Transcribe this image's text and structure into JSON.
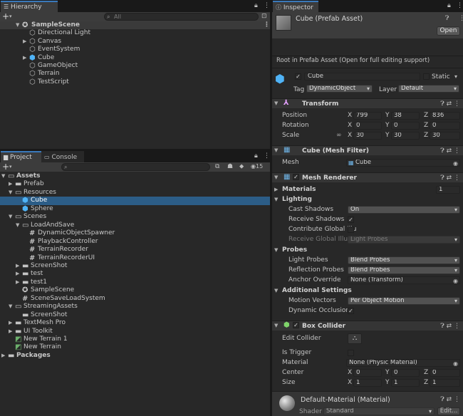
{
  "hierarchy": {
    "tab": "Hierarchy",
    "search_placeholder": "All",
    "add_label": "+",
    "scene": "SampleScene",
    "items": [
      {
        "label": "Directional Light",
        "icon": "gameobject-icon",
        "expandable": false
      },
      {
        "label": "Canvas",
        "icon": "gameobject-icon",
        "expandable": true
      },
      {
        "label": "EventSystem",
        "icon": "gameobject-icon",
        "expandable": false
      },
      {
        "label": "Cube",
        "icon": "prefab-cube-icon",
        "expandable": true
      },
      {
        "label": "GameObject",
        "icon": "gameobject-icon",
        "expandable": false
      },
      {
        "label": "Terrain",
        "icon": "gameobject-icon",
        "expandable": false
      },
      {
        "label": "TestScript",
        "icon": "gameobject-icon",
        "expandable": false
      }
    ]
  },
  "project": {
    "tab_project": "Project",
    "tab_console": "Console",
    "add_label": "+",
    "hidden_count": "15",
    "tree": [
      {
        "label": "Assets",
        "depth": 0,
        "icon": "folder-open-icon",
        "expand": "open",
        "bold": true
      },
      {
        "label": "Prefab",
        "depth": 1,
        "icon": "folder-icon",
        "expand": "closed"
      },
      {
        "label": "Resources",
        "depth": 1,
        "icon": "folder-open-icon",
        "expand": "open"
      },
      {
        "label": "Cube",
        "depth": 2,
        "icon": "prefab-cube-icon",
        "expand": "none",
        "selected": true
      },
      {
        "label": "Sphere",
        "depth": 2,
        "icon": "prefab-cube-icon",
        "expand": "none"
      },
      {
        "label": "Scenes",
        "depth": 1,
        "icon": "folder-open-icon",
        "expand": "open"
      },
      {
        "label": "LoadAndSave",
        "depth": 2,
        "icon": "folder-open-icon",
        "expand": "open"
      },
      {
        "label": "DynamicObjectSpawner",
        "depth": 3,
        "icon": "csharp-icon",
        "expand": "none"
      },
      {
        "label": "PlaybackController",
        "depth": 3,
        "icon": "csharp-icon",
        "expand": "none"
      },
      {
        "label": "TerrainRecorder",
        "depth": 3,
        "icon": "csharp-icon",
        "expand": "none"
      },
      {
        "label": "TerrainRecorderUI",
        "depth": 3,
        "icon": "csharp-icon",
        "expand": "none"
      },
      {
        "label": "ScreenShot",
        "depth": 2,
        "icon": "folder-icon",
        "expand": "closed"
      },
      {
        "label": "test",
        "depth": 2,
        "icon": "folder-icon",
        "expand": "closed"
      },
      {
        "label": "test1",
        "depth": 2,
        "icon": "folder-icon",
        "expand": "closed"
      },
      {
        "label": "SampleScene",
        "depth": 2,
        "icon": "unity-scene-icon",
        "expand": "none"
      },
      {
        "label": "SceneSaveLoadSystem",
        "depth": 2,
        "icon": "csharp-icon",
        "expand": "none"
      },
      {
        "label": "StreamingAssets",
        "depth": 1,
        "icon": "folder-open-icon",
        "expand": "open"
      },
      {
        "label": "ScreenShot",
        "depth": 2,
        "icon": "folder-icon",
        "expand": "none"
      },
      {
        "label": "TextMesh Pro",
        "depth": 1,
        "icon": "folder-icon",
        "expand": "closed"
      },
      {
        "label": "UI Toolkit",
        "depth": 1,
        "icon": "folder-icon",
        "expand": "closed"
      },
      {
        "label": "New Terrain 1",
        "depth": 1,
        "icon": "terrain-icon",
        "expand": "none"
      },
      {
        "label": "New Terrain",
        "depth": 1,
        "icon": "terrain-icon",
        "expand": "none"
      },
      {
        "label": "Packages",
        "depth": 0,
        "icon": "folder-icon",
        "expand": "closed",
        "bold": true
      }
    ]
  },
  "inspector": {
    "tab": "Inspector",
    "asset_title": "Cube (Prefab Asset)",
    "open_label": "Open",
    "root_note": "Root in Prefab Asset (Open for full editing support)",
    "name_field": "Cube",
    "static_label": "Static",
    "tag_label": "Tag",
    "tag_value": "DynamicObject",
    "layer_label": "Layer",
    "layer_value": "Default",
    "transform": {
      "title": "Transform",
      "position_label": "Position",
      "rotation_label": "Rotation",
      "scale_label": "Scale",
      "x": "X",
      "y": "Y",
      "z": "Z",
      "position": [
        "799",
        "38",
        "836"
      ],
      "rotation": [
        "0",
        "0",
        "0"
      ],
      "scale": [
        "30",
        "30",
        "30"
      ]
    },
    "mesh_filter": {
      "title": "Cube (Mesh Filter)",
      "mesh_label": "Mesh",
      "mesh_value": "Cube"
    },
    "mesh_renderer": {
      "title": "Mesh Renderer",
      "materials_label": "Materials",
      "materials_count": "1",
      "lighting_label": "Lighting",
      "cast_shadows_label": "Cast Shadows",
      "cast_shadows_value": "On",
      "receive_shadows_label": "Receive Shadows",
      "contribute_gi_label": "Contribute Global Illu",
      "receive_gi_label": "Receive Global Illum",
      "receive_gi_value": "Light Probes",
      "probes_label": "Probes",
      "light_probes_label": "Light Probes",
      "light_probes_value": "Blend Probes",
      "reflection_probes_label": "Reflection Probes",
      "reflection_probes_value": "Blend Probes",
      "anchor_override_label": "Anchor Override",
      "anchor_override_value": "None (Transform)",
      "additional_label": "Additional Settings",
      "motion_vectors_label": "Motion Vectors",
      "motion_vectors_value": "Per Object Motion",
      "dynamic_occlusion_label": "Dynamic Occlusion"
    },
    "box_collider": {
      "title": "Box Collider",
      "edit_collider_label": "Edit Collider",
      "is_trigger_label": "Is Trigger",
      "material_label": "Material",
      "material_value": "None (Physic Material)",
      "center_label": "Center",
      "size_label": "Size",
      "center": [
        "0",
        "0",
        "0"
      ],
      "size": [
        "1",
        "1",
        "1"
      ]
    },
    "material": {
      "title": "Default-Material (Material)",
      "shader_label": "Shader",
      "shader_value": "Standard",
      "edit_label": "Edit..."
    }
  }
}
